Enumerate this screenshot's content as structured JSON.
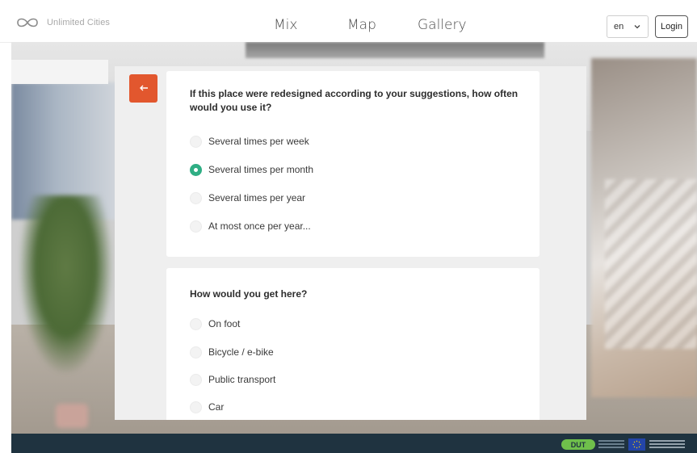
{
  "header": {
    "logo_text": "Unlimited Cities",
    "nav": [
      "Mix",
      "Map",
      "Gallery"
    ],
    "language": {
      "selected": "en"
    },
    "login_label": "Login"
  },
  "questions": [
    {
      "text": "If this place were redesigned according to your suggestions, how often would you use it?",
      "options": [
        {
          "label": "Several times per week",
          "selected": false
        },
        {
          "label": "Several times per month",
          "selected": true
        },
        {
          "label": "Several times per year",
          "selected": false
        },
        {
          "label": "At most once per year...",
          "selected": false
        }
      ]
    },
    {
      "text": "How would you get here?",
      "options": [
        {
          "label": "On foot",
          "selected": false
        },
        {
          "label": "Bicycle / e-bike",
          "selected": false
        },
        {
          "label": "Public transport",
          "selected": false
        },
        {
          "label": "Car",
          "selected": false
        }
      ]
    }
  ],
  "footer": {
    "dut_logo": "DUT"
  },
  "colors": {
    "accent_orange": "#e2572e",
    "radio_selected": "#2fae84",
    "footer_bg": "#1f3340"
  },
  "icons": {
    "logo": "infinity-icon",
    "back": "arrow-left-icon",
    "dropdown": "chevron-down-icon"
  }
}
